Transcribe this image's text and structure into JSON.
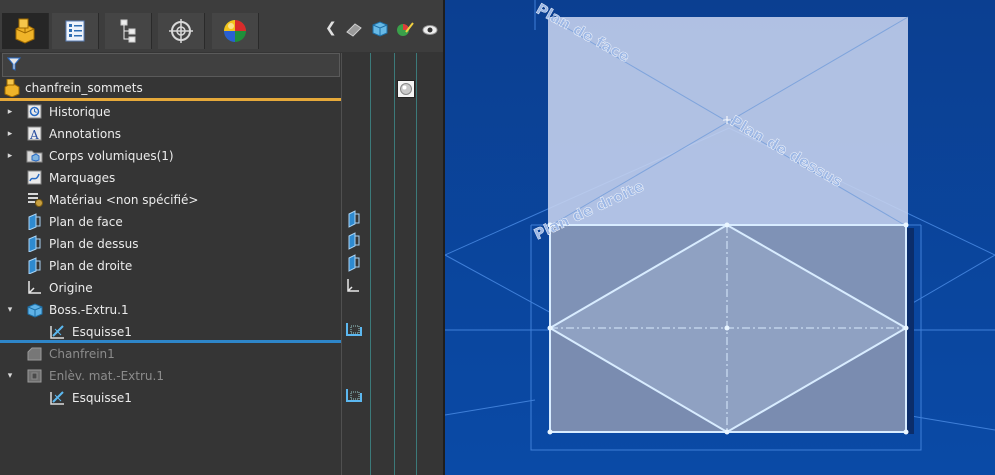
{
  "feature_manager": {
    "tabs": [
      {
        "name": "featuremanager-tab",
        "icon": "part-tree-icon",
        "active": true
      },
      {
        "name": "propertymanager-tab",
        "icon": "property-list-icon",
        "active": false
      },
      {
        "name": "configurationmanager-tab",
        "icon": "configuration-tree-icon",
        "active": false
      },
      {
        "name": "dimxpert-tab",
        "icon": "crosshair-target-icon",
        "active": false
      },
      {
        "name": "display-manager-tab",
        "icon": "appearance-sphere-icon",
        "active": false
      }
    ],
    "root": {
      "label": "chanfrein_sommets",
      "icon": "part-icon"
    },
    "items": [
      {
        "label": "Historique",
        "icon": "history-icon",
        "expandable": true,
        "expanded": false,
        "indent": 0,
        "suppressed": false
      },
      {
        "label": "Annotations",
        "icon": "annotations-icon",
        "expandable": true,
        "expanded": false,
        "indent": 0,
        "suppressed": false
      },
      {
        "label": "Corps volumiques(1)",
        "icon": "solid-bodies-folder-icon",
        "expandable": true,
        "expanded": false,
        "indent": 0,
        "suppressed": false
      },
      {
        "label": "Marquages",
        "icon": "markups-icon",
        "expandable": false,
        "expanded": false,
        "indent": 0,
        "suppressed": false
      },
      {
        "label": "Matériau <non spécifié>",
        "icon": "material-icon",
        "expandable": false,
        "expanded": false,
        "indent": 0,
        "suppressed": false
      },
      {
        "label": "Plan de face",
        "icon": "plane-icon",
        "expandable": false,
        "expanded": false,
        "indent": 0,
        "suppressed": false
      },
      {
        "label": "Plan de dessus",
        "icon": "plane-icon",
        "expandable": false,
        "expanded": false,
        "indent": 0,
        "suppressed": false
      },
      {
        "label": "Plan de droite",
        "icon": "plane-icon",
        "expandable": false,
        "expanded": false,
        "indent": 0,
        "suppressed": false
      },
      {
        "label": "Origine",
        "icon": "origin-icon",
        "expandable": false,
        "expanded": false,
        "indent": 0,
        "suppressed": false
      },
      {
        "label": "Boss.-Extru.1",
        "icon": "boss-extrude-icon",
        "expandable": true,
        "expanded": true,
        "indent": 0,
        "suppressed": false
      },
      {
        "label": "Esquisse1",
        "icon": "sketch-icon",
        "expandable": false,
        "expanded": false,
        "indent": 1,
        "suppressed": false
      },
      {
        "label": "Chanfrein1",
        "icon": "chamfer-icon",
        "expandable": false,
        "expanded": false,
        "indent": 0,
        "suppressed": true
      },
      {
        "label": "Enlèv. mat.-Extru.1",
        "icon": "cut-extrude-icon",
        "expandable": true,
        "expanded": true,
        "indent": 0,
        "suppressed": true
      },
      {
        "label": "Esquisse1",
        "icon": "sketch-icon",
        "expandable": false,
        "expanded": false,
        "indent": 1,
        "suppressed": false
      }
    ]
  },
  "viewport": {
    "plane_labels": [
      "Plan de face",
      "Plan de dessus",
      "Plan de droite"
    ]
  }
}
